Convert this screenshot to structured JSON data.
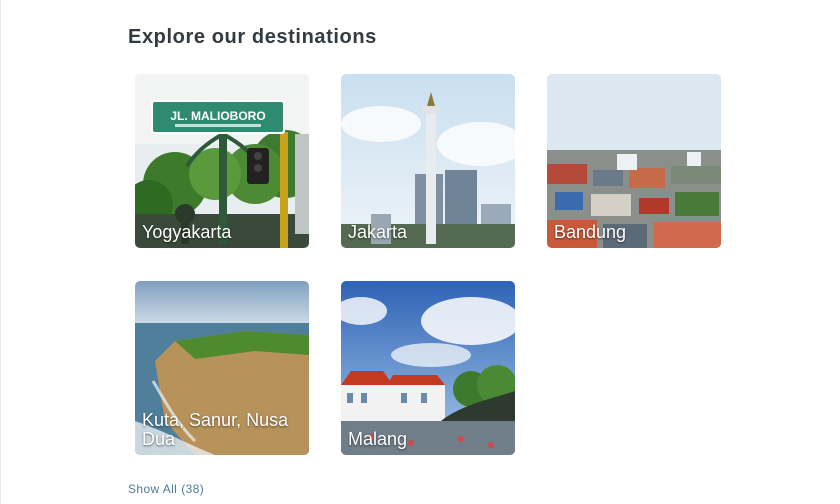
{
  "section": {
    "title": "Explore our destinations",
    "show_all_label": "Show All",
    "show_all_count": "(38)"
  },
  "destinations": [
    {
      "label": "Yogyakarta",
      "sign_text": "JL. MALIOBORO"
    },
    {
      "label": "Jakarta"
    },
    {
      "label": "Bandung"
    },
    {
      "label": "Kuta, Sanur, Nusa Dua"
    },
    {
      "label": "Malang"
    }
  ]
}
